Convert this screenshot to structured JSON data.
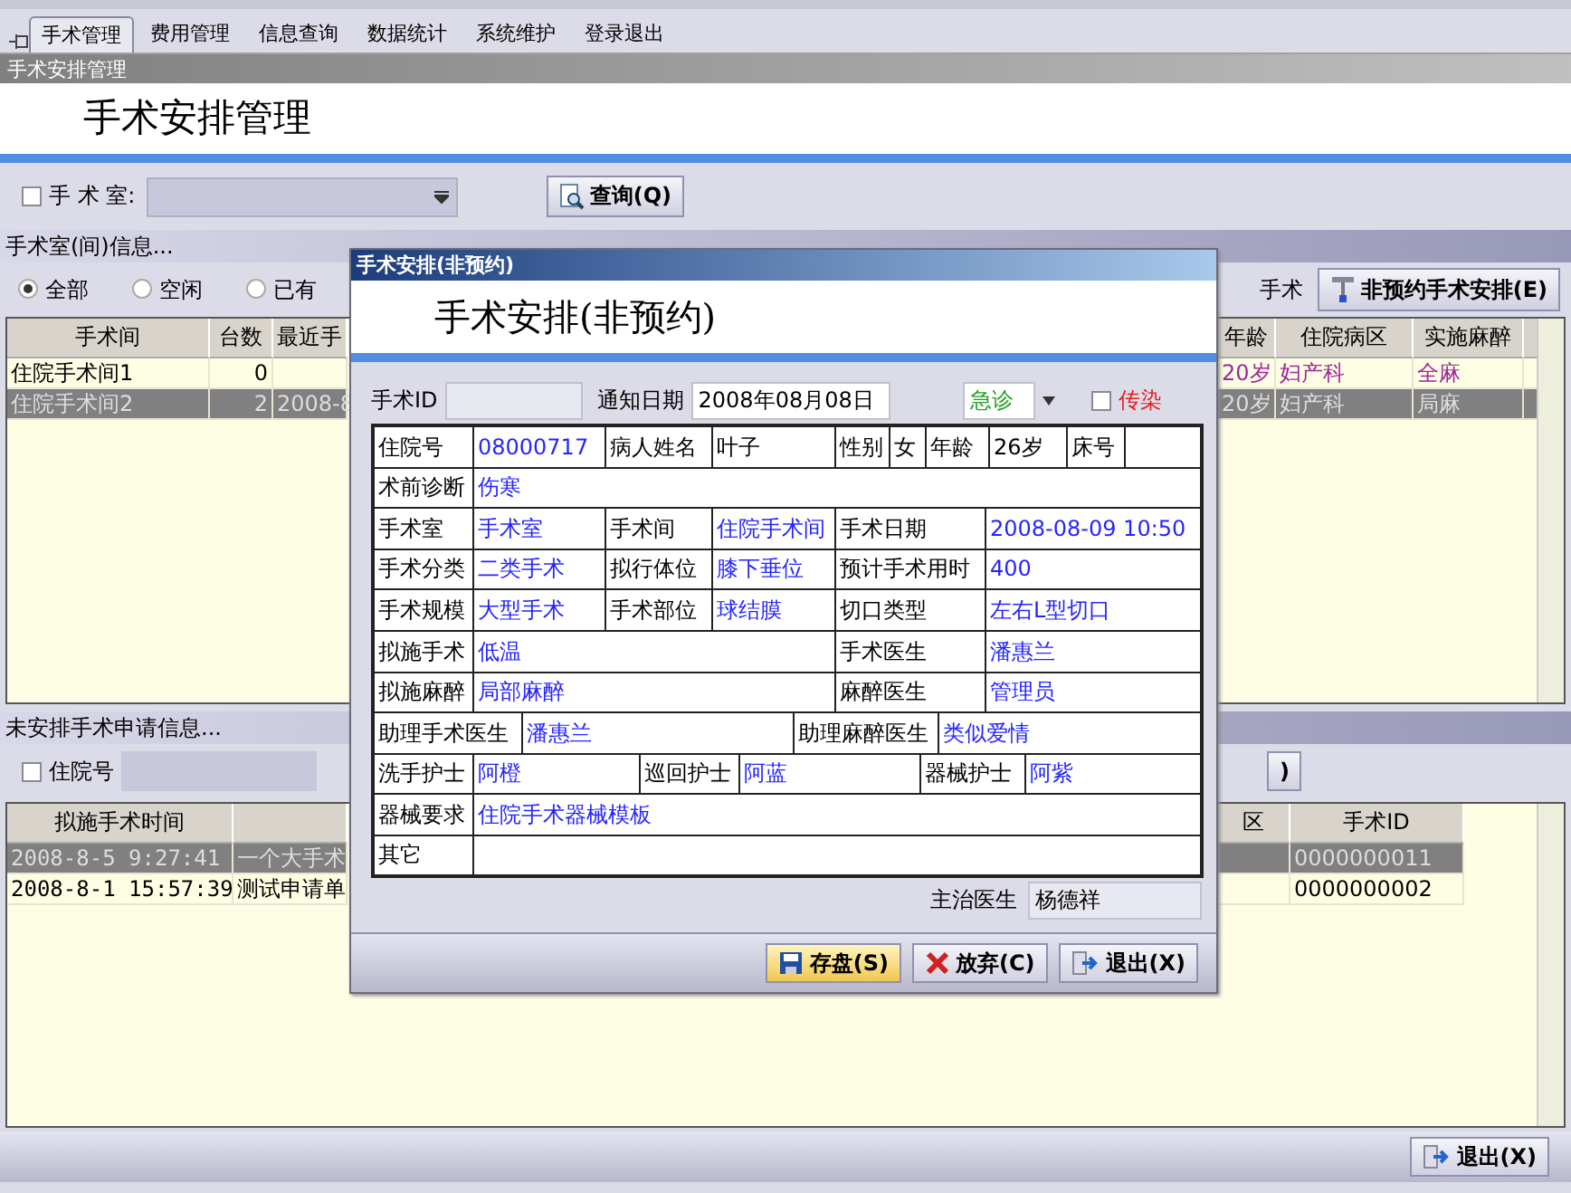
{
  "menu_tabs": [
    {
      "label": "手术管理",
      "selected": true
    },
    {
      "label": "费用管理",
      "selected": false
    },
    {
      "label": "信息查询",
      "selected": false
    },
    {
      "label": "数据统计",
      "selected": false
    },
    {
      "label": "系统维护",
      "selected": false
    },
    {
      "label": "登录退出",
      "selected": false
    }
  ],
  "page": {
    "caption": "手术安排管理",
    "heading": "手术安排管理"
  },
  "filter": {
    "room_checkbox": {
      "label": "手 术 室:",
      "checked": false
    },
    "query_button": "查询(Q)"
  },
  "room_section": {
    "title": "手术室(间)信息...",
    "radios": [
      {
        "label": "全部",
        "selected": true
      },
      {
        "label": "空闲",
        "selected": false
      },
      {
        "label": "已有",
        "selected": false
      }
    ],
    "right_label": "手术",
    "arrange_button": "非预约手术安排(E)",
    "left_columns": [
      "手术间",
      "台数",
      "最近手"
    ],
    "right_columns": [
      "年龄",
      "住院病区",
      "实施麻醉"
    ],
    "rows": [
      {
        "room": "住院手术间1",
        "count": "0",
        "age": "20岁",
        "ward": "妇产科",
        "anesthesia": "全麻",
        "selected": false
      },
      {
        "room": "住院手术间2",
        "count": "2",
        "recent": "2008-8",
        "age": "20岁",
        "ward": "妇产科",
        "anesthesia": "局麻",
        "selected": true
      }
    ]
  },
  "request_section": {
    "title": "未安排手术申请信息...",
    "inpatient_checkbox": {
      "label": "住院号",
      "checked": false
    },
    "filter_button_tail": ")",
    "left_columns": [
      "拟施手术时间"
    ],
    "right_columns": [
      "区",
      "手术ID"
    ],
    "rows": [
      {
        "time": "2008-8-5 9:27:41",
        "summary": "一个大手术",
        "surgery_id": "0000000011",
        "selected": true
      },
      {
        "time": "2008-8-1 15:57:39",
        "summary": "测试申请单",
        "surgery_id": "0000000002",
        "selected": false
      }
    ]
  },
  "exit_button": "退出(X)",
  "dialog": {
    "title": "手术安排(非预约)",
    "heading": "手术安排(非预约)",
    "id_label": "手术ID",
    "notice_label": "通知日期",
    "notice_date": "2008年08月08日",
    "urgency": "急诊",
    "infectious": {
      "label": "传染",
      "checked": false
    },
    "form_rows": [
      [
        {
          "kind": "label",
          "text": "住院号"
        },
        {
          "kind": "value",
          "text": "08000717"
        },
        {
          "kind": "label",
          "text": "病人姓名"
        },
        {
          "kind": "plain",
          "text": "叶子"
        },
        {
          "kind": "label",
          "text": "性别"
        },
        {
          "kind": "plain",
          "text": "女"
        },
        {
          "kind": "label",
          "text": "年龄"
        },
        {
          "kind": "plain",
          "text": "26岁"
        },
        {
          "kind": "label",
          "text": "床号"
        },
        {
          "kind": "plain"
        }
      ],
      [
        {
          "kind": "label",
          "text": "术前诊断"
        },
        {
          "kind": "value",
          "text": "伤寒"
        }
      ],
      [
        {
          "kind": "label",
          "text": "手术室"
        },
        {
          "kind": "value",
          "text": "手术室"
        },
        {
          "kind": "label",
          "text": "手术间"
        },
        {
          "kind": "value",
          "text": "住院手术间"
        },
        {
          "kind": "label",
          "text": "手术日期"
        },
        {
          "kind": "value",
          "text": "2008-08-09 10:50"
        }
      ],
      [
        {
          "kind": "label",
          "text": "手术分类"
        },
        {
          "kind": "value",
          "text": "二类手术"
        },
        {
          "kind": "label",
          "text": "拟行体位"
        },
        {
          "kind": "value",
          "text": "膝下垂位"
        },
        {
          "kind": "label",
          "text": "预计手术用时"
        },
        {
          "kind": "value",
          "text": "400"
        }
      ],
      [
        {
          "kind": "label",
          "text": "手术规模"
        },
        {
          "kind": "value",
          "text": "大型手术"
        },
        {
          "kind": "label",
          "text": "手术部位"
        },
        {
          "kind": "value",
          "text": "球结膜"
        },
        {
          "kind": "label",
          "text": "切口类型"
        },
        {
          "kind": "value",
          "text": "左右L型切口"
        }
      ],
      [
        {
          "kind": "label",
          "text": "拟施手术"
        },
        {
          "kind": "value",
          "text": "低温"
        },
        {
          "kind": "label",
          "text": "手术医生"
        },
        {
          "kind": "value",
          "text": "潘惠兰"
        }
      ],
      [
        {
          "kind": "label",
          "text": "拟施麻醉"
        },
        {
          "kind": "value",
          "text": "局部麻醉"
        },
        {
          "kind": "label",
          "text": "麻醉医生"
        },
        {
          "kind": "value",
          "text": "管理员"
        }
      ],
      [
        {
          "kind": "label",
          "text": "助理手术医生"
        },
        {
          "kind": "value",
          "text": "潘惠兰"
        },
        {
          "kind": "label",
          "text": "助理麻醉医生"
        },
        {
          "kind": "value",
          "text": "类似爱情"
        }
      ],
      [
        {
          "kind": "label",
          "text": "洗手护士"
        },
        {
          "kind": "value",
          "text": "阿橙"
        },
        {
          "kind": "label",
          "text": "巡回护士"
        },
        {
          "kind": "value",
          "text": "阿蓝"
        },
        {
          "kind": "label",
          "text": "器械护士"
        },
        {
          "kind": "value",
          "text": "阿紫"
        }
      ],
      [
        {
          "kind": "label",
          "text": "器械要求"
        },
        {
          "kind": "value",
          "text": "住院手术器械模板"
        }
      ],
      [
        {
          "kind": "label",
          "text": "其它"
        },
        {
          "kind": "value"
        }
      ]
    ],
    "attending": {
      "label": "主治医生",
      "value": "杨德祥"
    },
    "buttons": [
      {
        "kind": "save",
        "label": "存盘(S)"
      },
      {
        "kind": "cancel",
        "label": "放弃(C)"
      },
      {
        "kind": "exit",
        "label": "退出(X)"
      }
    ]
  }
}
